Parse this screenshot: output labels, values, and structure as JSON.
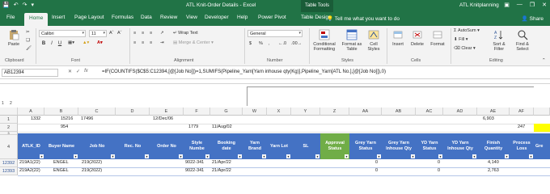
{
  "titlebar": {
    "doc_title": "ATL Knit-Order Details  -  Excel",
    "context_tab": "Table Tools",
    "user": "ATL Knitplanning",
    "qat_icons": [
      "save-icon",
      "undo-icon",
      "redo-icon",
      "customize-icon"
    ]
  },
  "tabs": [
    {
      "label": "File"
    },
    {
      "label": "Home"
    },
    {
      "label": "Insert"
    },
    {
      "label": "Page Layout"
    },
    {
      "label": "Formulas"
    },
    {
      "label": "Data"
    },
    {
      "label": "Review"
    },
    {
      "label": "View"
    },
    {
      "label": "Developer"
    },
    {
      "label": "Help"
    },
    {
      "label": "Power Pivot"
    },
    {
      "label": "Table Design"
    }
  ],
  "tell_me": "Tell me what you want to do",
  "share": "Share",
  "ribbon": {
    "clipboard": {
      "paste": "Paste",
      "label": "Clipboard"
    },
    "font": {
      "name": "Calibri",
      "size": "11",
      "bold": "B",
      "italic": "I",
      "underline": "U",
      "label": "Font"
    },
    "alignment": {
      "wrap": "Wrap Text",
      "merge": "Merge & Center",
      "label": "Alignment"
    },
    "number": {
      "format": "General",
      "currency": "$",
      "percent": "%",
      "comma": ",",
      "label": "Number"
    },
    "styles": {
      "conditional": "Conditional",
      "conditional2": "Formatting",
      "format_as": "Format as",
      "format_as2": "Table",
      "cell": "Cell",
      "cell2": "Styles",
      "label": "Styles"
    },
    "cells": {
      "insert": "Insert",
      "delete": "Delete",
      "format": "Format",
      "label": "Cells"
    },
    "editing": {
      "autosum": "AutoSum",
      "fill": "Fill",
      "clear": "Clear",
      "sort": "Sort &",
      "sort2": "Filter",
      "find": "Find &",
      "find2": "Select",
      "label": "Editing"
    }
  },
  "formula_bar": {
    "name_box": "AB12394",
    "formula": "=IF(COUNTIFS($C$5:C12394,[@[Job No]])=1,SUMIFS(Pipeline_Yarn[Yarn inhouse qty(Kg)],Pipeline_Yarn[ATL No.],[@[Job No]]),0)"
  },
  "columns": [
    "A",
    "B",
    "C",
    "D",
    "E",
    "F",
    "G",
    "W",
    "X",
    "Y",
    "Z",
    "AA",
    "AB",
    "AC",
    "AD",
    "AE",
    "AF"
  ],
  "row_numbers": {
    "r1": "1",
    "r2": "2",
    "r3": "3",
    "r4": "4",
    "r5": "12392",
    "r6": "12393"
  },
  "summary_rows": {
    "row1": {
      "A": "1332",
      "B": "15216",
      "C": "17496",
      "E": "12/Dec/06",
      "AE": "6,903"
    },
    "row2": {
      "B": "954",
      "F": "1779",
      "G": "11/Aug/02",
      "AF": "247"
    }
  },
  "headers": [
    "ATLK_ID",
    "Buyer Name",
    "Job No",
    "Rec. No",
    "Order No",
    "Style Numbe",
    "Booking date",
    "Yarn Brand",
    "Yarn Lot",
    "SL",
    "Approval Status",
    "Grey Yarn Status",
    "Grey Yarn Inhouse Qty",
    "YD Yarn Status",
    "YD Yarn Inhouse Qty",
    "Finish Quantity",
    "Process Loss",
    "Gre"
  ],
  "rows": [
    {
      "A": "219A1(22)",
      "B": "ENGEL",
      "C": "219(2022)",
      "F": "9022-341",
      "G": "21/Apr/22",
      "AA": "0",
      "AC": "0",
      "AE": "4,140"
    },
    {
      "A": "219A2(22)",
      "B": "ENGEL",
      "C": "219(2022)",
      "F": "9022-341",
      "G": "21/Apr/22",
      "AA": "0",
      "AC": "0",
      "AE": "2,763"
    }
  ],
  "colors": {
    "excel_green": "#217346",
    "table_header": "#4472c4",
    "status_header": "#70ad47",
    "highlight": "#ffff00"
  }
}
